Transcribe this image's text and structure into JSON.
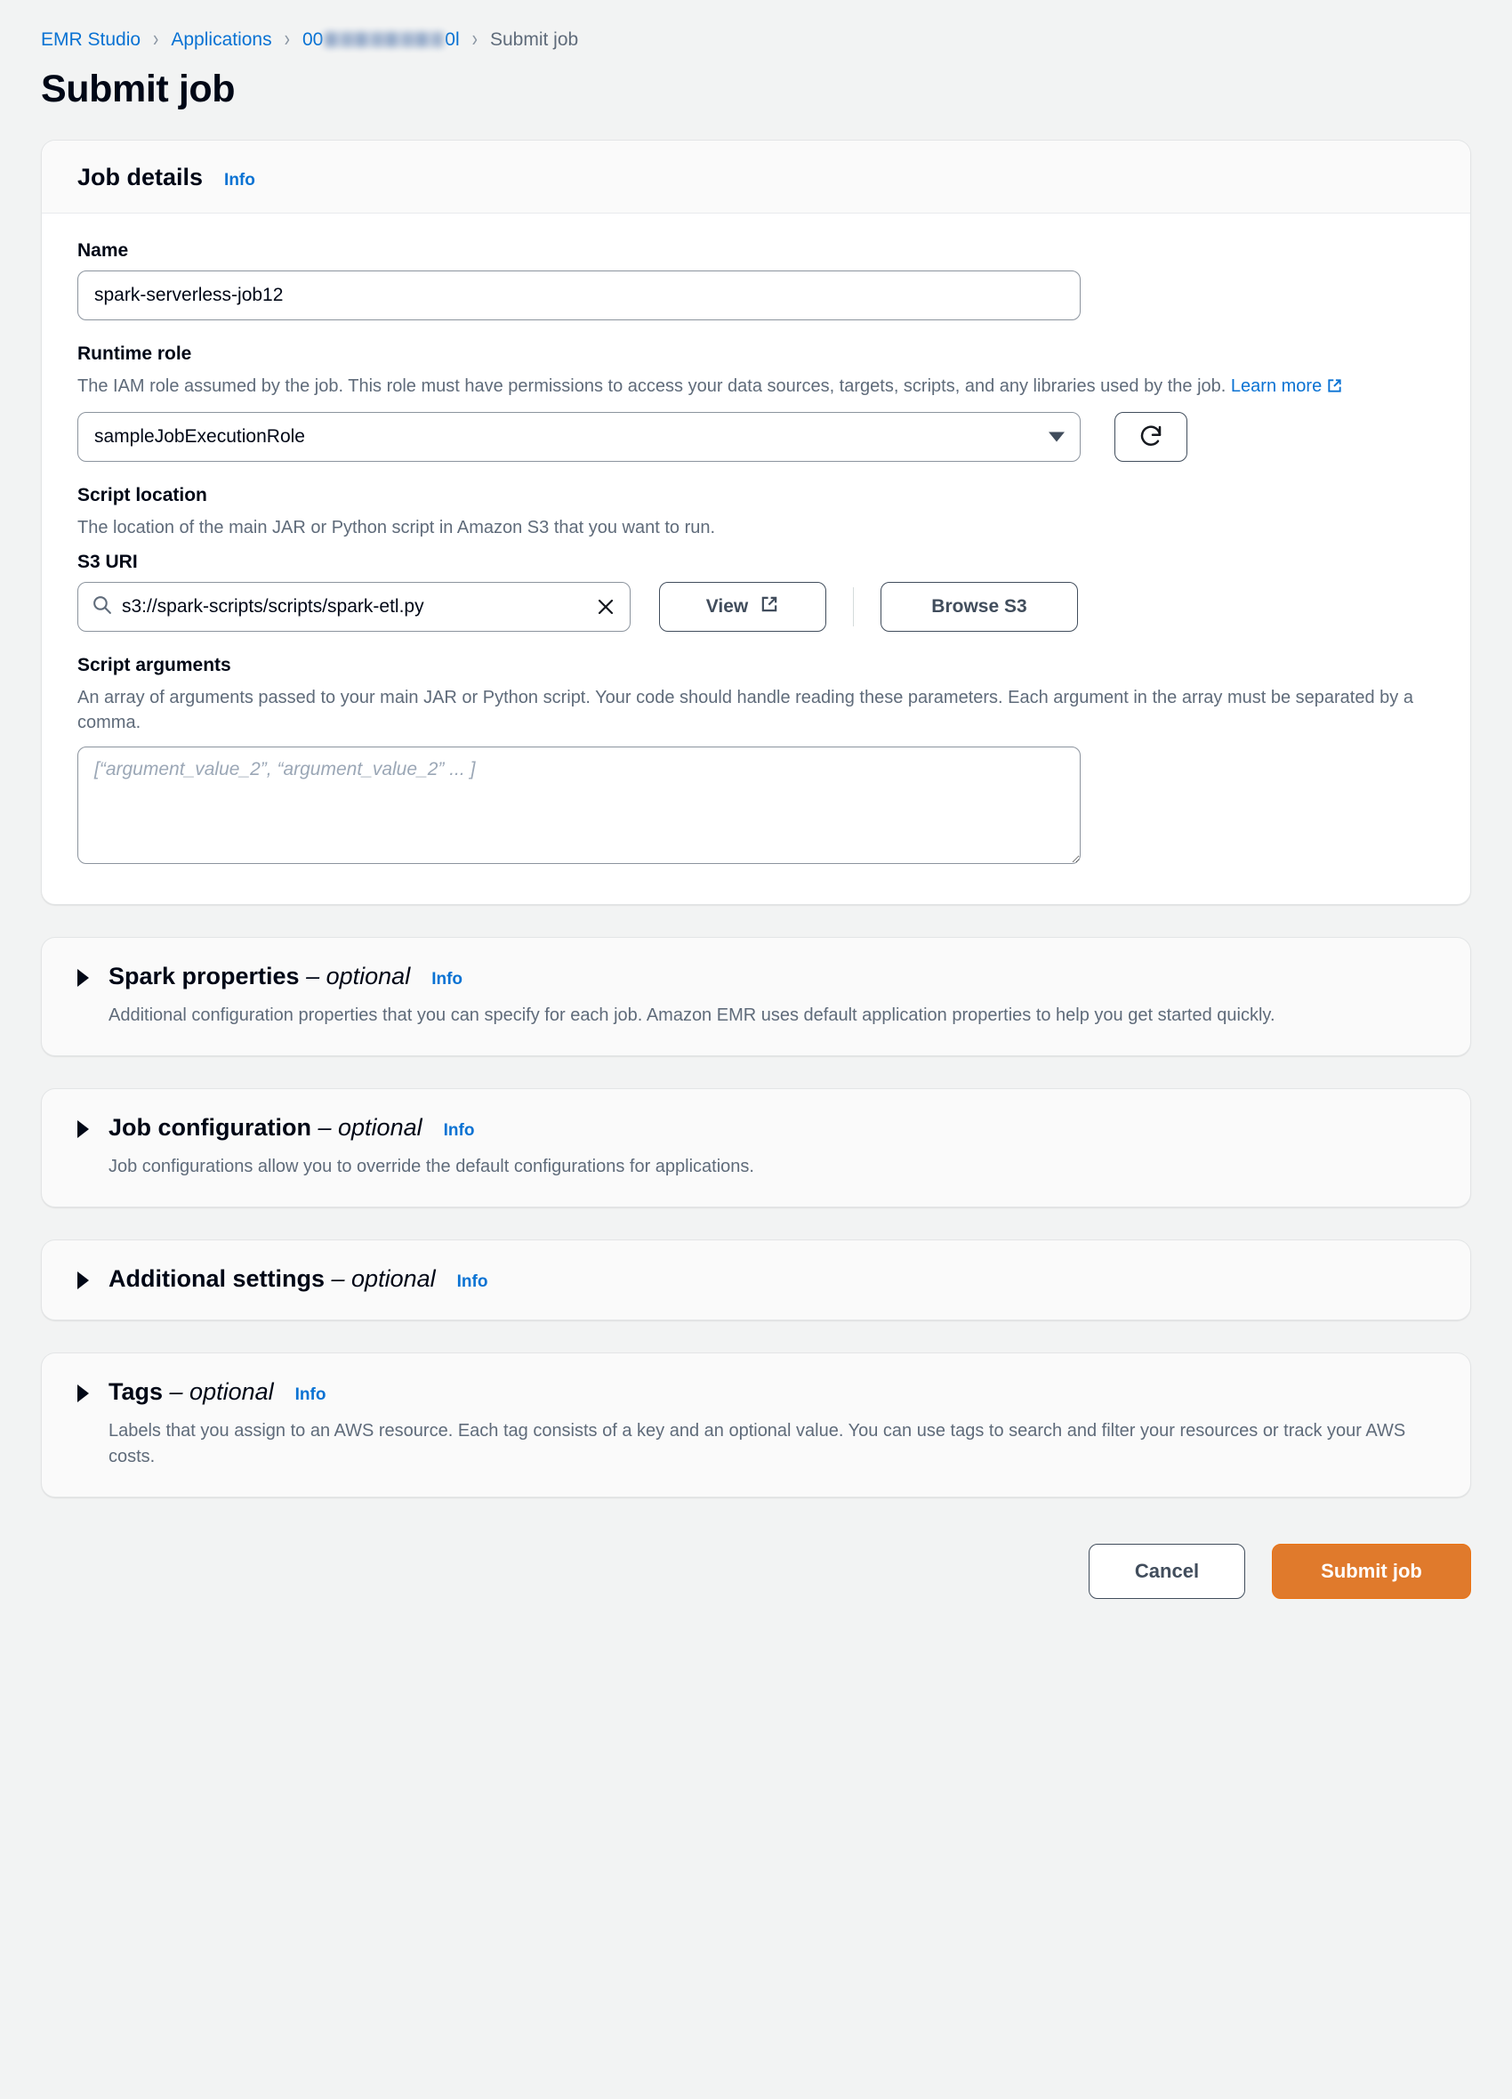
{
  "breadcrumb": {
    "items": [
      {
        "label": "EMR Studio",
        "type": "link"
      },
      {
        "label": "Applications",
        "type": "link"
      },
      {
        "label_prefix": "00",
        "label_suffix": "0l",
        "type": "redacted-link"
      },
      {
        "label": "Submit job",
        "type": "current"
      }
    ],
    "separator": "›"
  },
  "page": {
    "title": "Submit job"
  },
  "job_details": {
    "heading": "Job details",
    "info_label": "Info",
    "name": {
      "label": "Name",
      "value": "spark-serverless-job12"
    },
    "runtime_role": {
      "label": "Runtime role",
      "description": "The IAM role assumed by the job. This role must have permissions to access your data sources, targets, scripts, and any libraries used by the job.",
      "learn_more": "Learn more",
      "selected_value": "sampleJobExecutionRole",
      "refresh_icon": "refresh-icon"
    },
    "script_location": {
      "label": "Script location",
      "description": "The location of the main JAR or Python script in Amazon S3 that you want to run.",
      "s3_uri_label": "S3 URI",
      "s3_uri_value": "s3://spark-scripts/scripts/spark-etl.py",
      "search_icon": "search-icon",
      "clear_icon": "clear-icon",
      "view_button": "View",
      "view_icon": "external-link-icon",
      "browse_button": "Browse S3"
    },
    "script_arguments": {
      "label": "Script arguments",
      "description": "An array of arguments passed to your main JAR or Python script. Your code should handle reading these parameters. Each argument in the array must be separated by a comma.",
      "placeholder": "[“argument_value_2”, “argument_value_2” ... ]",
      "value": ""
    }
  },
  "sections": [
    {
      "title": "Spark properties",
      "optional": "– optional",
      "info_label": "Info",
      "description": "Additional configuration properties that you can specify for each job. Amazon EMR uses default application properties to help you get started quickly.",
      "expanded": false
    },
    {
      "title": "Job configuration",
      "optional": "– optional",
      "info_label": "Info",
      "description": "Job configurations allow you to override the default configurations for applications.",
      "expanded": false
    },
    {
      "title": "Additional settings",
      "optional": "– optional",
      "info_label": "Info",
      "description": "",
      "expanded": false
    },
    {
      "title": "Tags",
      "optional": "– optional",
      "info_label": "Info",
      "description": "Labels that you assign to an AWS resource. Each tag consists of a key and an optional value. You can use tags to search and filter your resources or track your AWS costs.",
      "expanded": false
    }
  ],
  "footer": {
    "cancel_label": "Cancel",
    "submit_label": "Submit job"
  },
  "colors": {
    "link": "#0972d3",
    "primary_button": "#e07a2c",
    "page_background": "#f2f3f3",
    "card_background": "#ffffff",
    "muted_text": "#5f6b7a"
  }
}
